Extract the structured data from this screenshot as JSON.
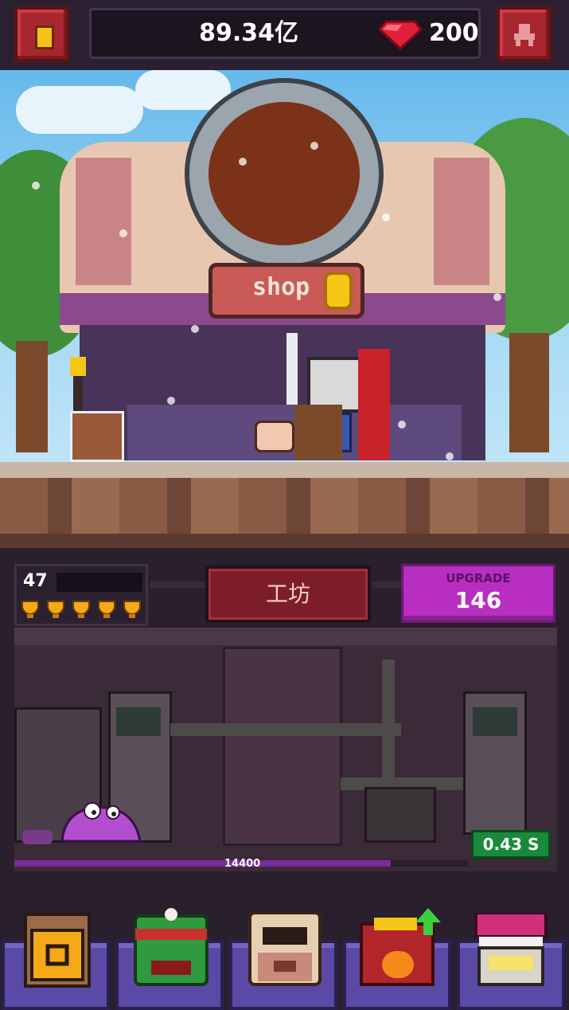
{
  "top_bar": {
    "gold_amount": "89.34亿",
    "gem_count": "200",
    "menu_icon": "book-icon",
    "profile_icon": "character-icon"
  },
  "scene": {
    "shop_sign": "shop"
  },
  "workshop": {
    "level": "47",
    "title": "工坊",
    "upgrade_label": "UPGRADE",
    "upgrade_cost": "146",
    "rate": "0.43 S",
    "progress_value": "14400",
    "progress_fraction": 0.83
  },
  "bottom_nav": {
    "items": [
      {
        "icon": "backpack-icon"
      },
      {
        "icon": "frog-hero-icon"
      },
      {
        "icon": "monster-hero-icon"
      },
      {
        "icon": "forge-upgrade-icon"
      },
      {
        "icon": "store-icon"
      }
    ]
  },
  "colors": {
    "accent_purple": "#b72ec0",
    "brand_red": "#a8262e",
    "rate_green": "#188a3a"
  }
}
